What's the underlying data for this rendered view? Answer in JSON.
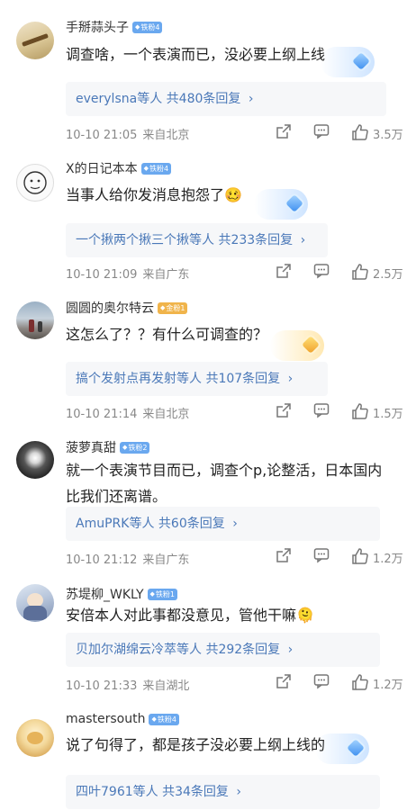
{
  "comments": [
    {
      "username": "手掰蒜头子",
      "badge": "铁粉4",
      "text": [
        "调查啥，一个表演而已，没必要上纲上线"
      ],
      "replies_who": "everylsna等人",
      "replies_count": "共480条回复",
      "time": "10-10 21:05",
      "location": "来自北京",
      "likes": "3.5万"
    },
    {
      "username": "X的日记本本",
      "badge": "铁粉4",
      "text": [
        "当事人给你发消息抱怨了🥴"
      ],
      "replies_who": "一个揪两个揪三个揪等人",
      "replies_count": "共233条回复",
      "time": "10-10 21:09",
      "location": "来自广东",
      "likes": "2.5万"
    },
    {
      "username": "圆圆的奥尔特云",
      "badge": "金粉1",
      "text": [
        "这怎么了？？有什么可调查的？"
      ],
      "replies_who": "搞个发射点再发射等人",
      "replies_count": "共107条回复",
      "time": "10-10 21:14",
      "location": "来自北京",
      "likes": "1.5万"
    },
    {
      "username": "菠萝真甜",
      "badge": "铁粉2",
      "text": [
        "就一个表演节目而已，调查个p,论整活，日本国内",
        "比我们还离谱。"
      ],
      "replies_who": "AmuPRK等人",
      "replies_count": "共60条回复",
      "time": "10-10 21:12",
      "location": "来自广东",
      "likes": "1.2万"
    },
    {
      "username": "苏堤柳_WKLY",
      "badge": "铁粉1",
      "text": [
        "安倍本人对此事都没意见，管他干嘛🫠"
      ],
      "replies_who": "贝加尔湖绵云冷萃等人",
      "replies_count": "共292条回复",
      "time": "10-10 21:33",
      "location": "来自湖北",
      "likes": "1.2万"
    },
    {
      "username": "mastersouth",
      "badge": "铁粉4",
      "text": [
        "说了句得了，都是孩子没必要上纲上线的"
      ],
      "replies_who": "四叶7961等人",
      "replies_count": "共34条回复",
      "time": "",
      "location": "",
      "likes": ""
    }
  ],
  "ui": {
    "chevron": "›",
    "icons": [
      "share-icon",
      "comment-icon",
      "like-icon",
      "gem-icon",
      "fan-badge-icon"
    ],
    "colors": {
      "link": "#4a78b8",
      "badge_iron": "#6aa8ef",
      "badge_gold": "#f0b44b",
      "meta": "#888888"
    }
  }
}
